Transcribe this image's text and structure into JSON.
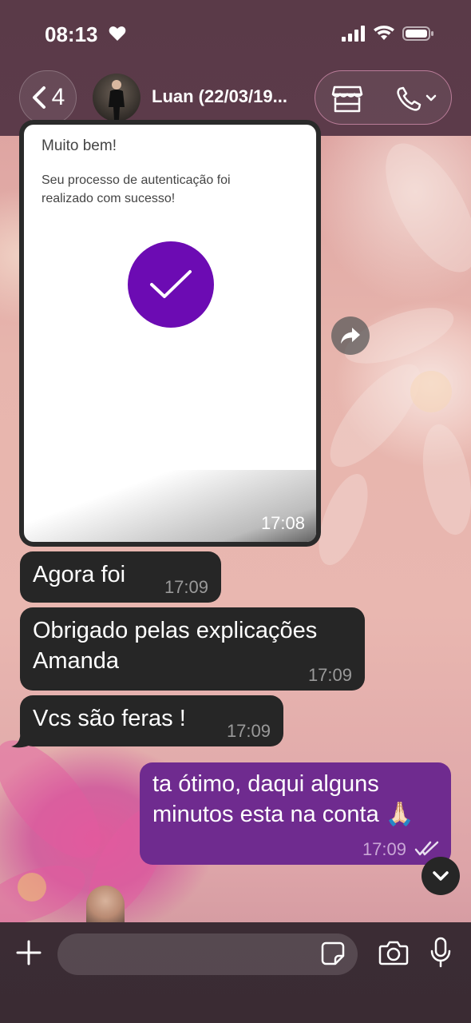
{
  "status_bar": {
    "time": "08:13"
  },
  "header": {
    "back_count": "4",
    "contact_name": "Luan (22/03/19..."
  },
  "messages": [
    {
      "type": "image",
      "direction": "in",
      "image_title": "Muito bem!",
      "image_text": "Seu processo de autenticação foi realizado com sucesso!",
      "time": "17:08"
    },
    {
      "type": "text",
      "direction": "in",
      "text": "Agora foi",
      "time": "17:09"
    },
    {
      "type": "text",
      "direction": "in",
      "text_line1": "Obrigado pelas explicações",
      "text_line2": "Amanda",
      "time": "17:09"
    },
    {
      "type": "text",
      "direction": "in",
      "text": "Vcs são feras !",
      "time": "17:09"
    },
    {
      "type": "text",
      "direction": "out",
      "text_line1": "ta ótimo, daqui alguns",
      "text_line2": "minutos esta na conta 🙏🏻",
      "time": "17:09",
      "status": "read"
    }
  ],
  "colors": {
    "incoming_bubble": "#262626",
    "outgoing_bubble": "#6f2b8f",
    "check_circle": "#6c0bb3",
    "header_bg": "#5a3a48",
    "read_ticks": "#e8dff0"
  }
}
